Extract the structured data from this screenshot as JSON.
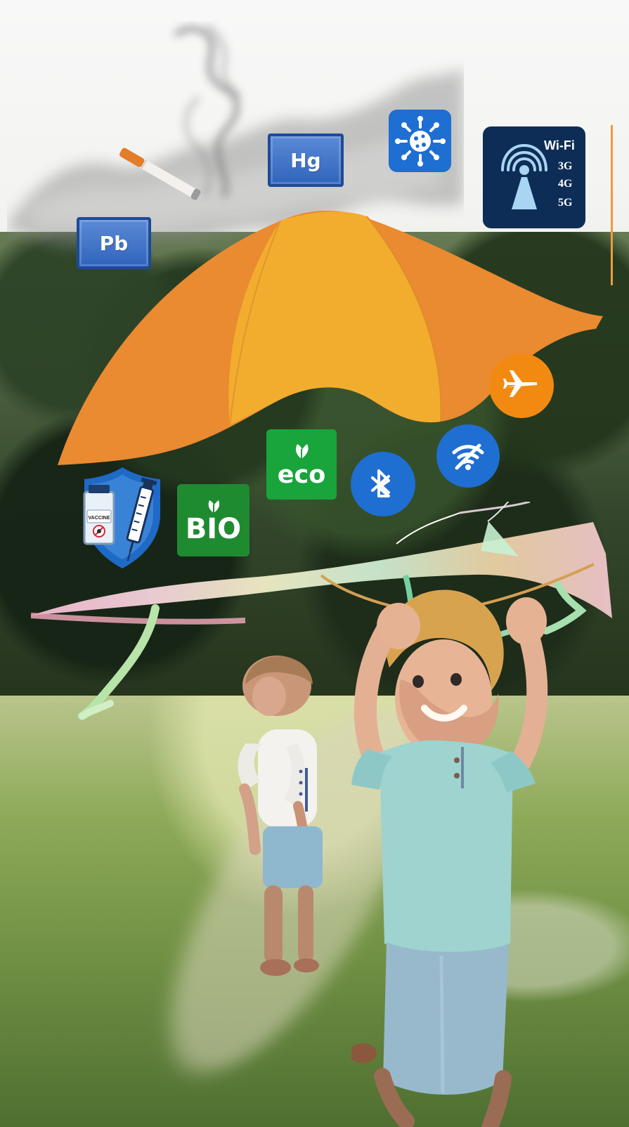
{
  "pollutants": {
    "pb": "Pb",
    "hg": "Hg"
  },
  "network": {
    "wifi": "Wi-Fi",
    "g3": "3G",
    "g4": "4G",
    "g5": "5G"
  },
  "labels": {
    "eco": "eco",
    "bio": "BIO",
    "vaccine": "VACCINE"
  },
  "icons": {
    "virus": "virus-icon",
    "cigarette": "cigarette-icon",
    "antenna": "antenna-icon",
    "airplane": "airplane-mode-icon",
    "wifi_off": "wifi-off-icon",
    "bluetooth": "bluetooth-icon",
    "leaf": "leaf-icon",
    "shield": "shield-icon",
    "syringe": "syringe-icon",
    "umbrella": "umbrella-icon",
    "kite": "kite-icon"
  },
  "colors": {
    "umbrella_primary": "#eb8a32",
    "umbrella_secondary": "#f2ad2e",
    "blue_badge": "#1f6ed1",
    "navy_badge": "#0d2d56",
    "green_badge": "#19a43c",
    "airplane_circle": "#f28a12"
  }
}
